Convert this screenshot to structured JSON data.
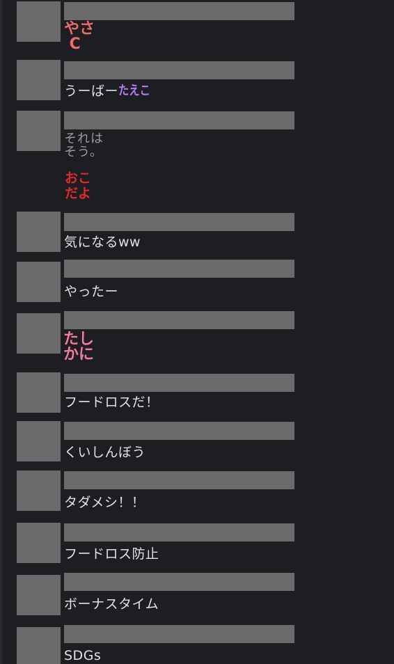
{
  "colors": {
    "background": "#1d1e22",
    "placeholder": "#6a6a6a",
    "text": "#e2e2e2",
    "stamp_yasa": "#f06a6a",
    "stamp_taeko": "#b57cf0",
    "stamp_oko": "#e02a2a",
    "stamp_tashika": "#f07aa0"
  },
  "messages": [
    {
      "stamp": "やさ\n C"
    },
    {
      "text": "うーばー",
      "stamp": "たえこ"
    },
    {
      "text": "それは\nそう。",
      "stamp": "おこ\nだよ"
    },
    {
      "text": "気になるww"
    },
    {
      "text": "やったー"
    },
    {
      "stamp": "たし\nかに"
    },
    {
      "text": "フードロスだ！"
    },
    {
      "text": "くいしんぼう"
    },
    {
      "text": "タダメシ！！"
    },
    {
      "text": "フードロス防止"
    },
    {
      "text": "ボーナスタイム"
    },
    {
      "text": "SDGs"
    }
  ]
}
